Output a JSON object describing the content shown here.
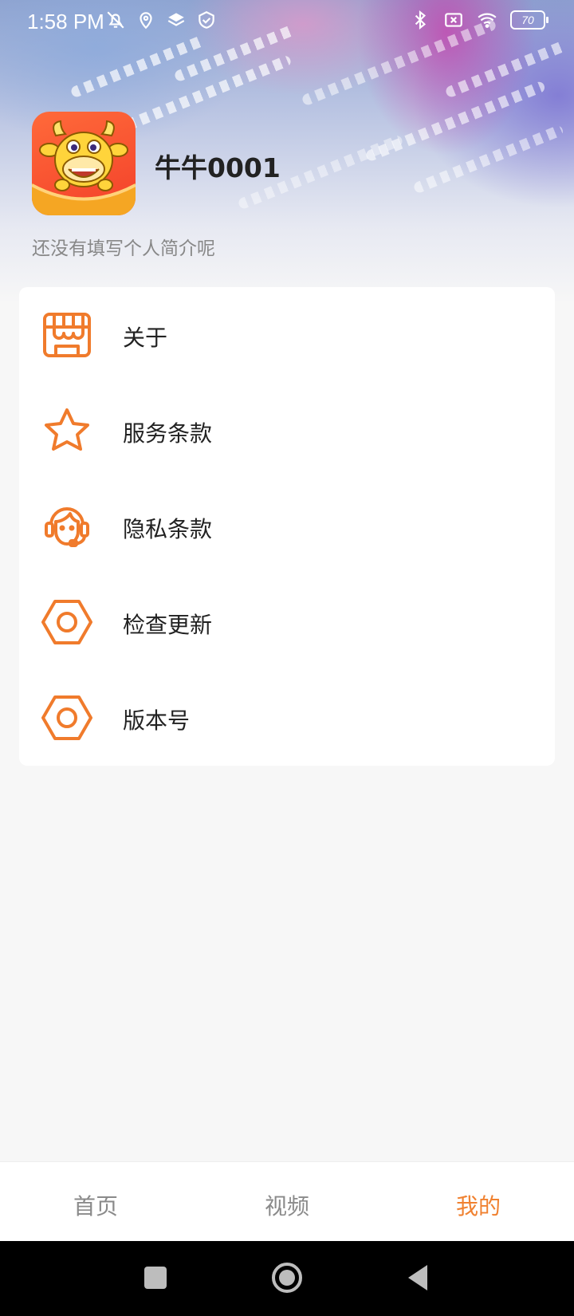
{
  "status_bar": {
    "time": "1:58 PM",
    "battery_level": "70",
    "icons_left": [
      "mute-bell-icon",
      "location-icon",
      "layers-icon",
      "shield-icon"
    ],
    "icons_right": [
      "bluetooth-icon",
      "sim-x-icon",
      "wifi-icon",
      "battery-icon"
    ]
  },
  "profile": {
    "username": "牛牛0001",
    "bio": "还没有填写个人简介呢"
  },
  "menu": {
    "items": [
      {
        "label": "关于",
        "icon": "store-icon"
      },
      {
        "label": "服务条款",
        "icon": "star-icon"
      },
      {
        "label": "隐私条款",
        "icon": "headset-icon"
      },
      {
        "label": "检查更新",
        "icon": "hexagon-icon"
      },
      {
        "label": "版本号",
        "icon": "hexagon-icon"
      }
    ]
  },
  "tabs": {
    "items": [
      {
        "label": "首页"
      },
      {
        "label": "视频"
      },
      {
        "label": "我的"
      }
    ],
    "active": "我的"
  },
  "colors": {
    "accent": "#f08130",
    "icon": "#f07b2c",
    "text": "#222222",
    "muted": "#888888"
  }
}
